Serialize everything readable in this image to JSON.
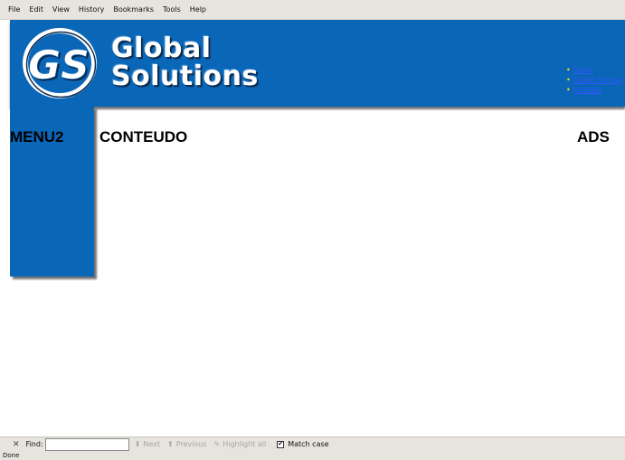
{
  "menubar": {
    "items": [
      "File",
      "Edit",
      "View",
      "History",
      "Bookmarks",
      "Tools",
      "Help"
    ]
  },
  "header": {
    "logo_text": "GS",
    "brand_line1": "Global",
    "brand_line2": "Solutions",
    "nav": [
      "Inicio",
      "Quem Somos",
      "Contato"
    ],
    "colors": {
      "banner": "#0a66b7",
      "nav_bullet": "#ffe300",
      "nav_link": "#3355ff"
    }
  },
  "sidebar": {
    "title": "MENU2"
  },
  "content": {
    "title": "CONTEUDO"
  },
  "ads": {
    "title": "ADS"
  },
  "findbar": {
    "close_icon": "close-icon",
    "label": "Find:",
    "value": "",
    "next": "Next",
    "previous": "Previous",
    "highlight": "Highlight all",
    "match_case": "Match case",
    "match_case_checked": true
  },
  "statusbar": {
    "text": "Done"
  }
}
